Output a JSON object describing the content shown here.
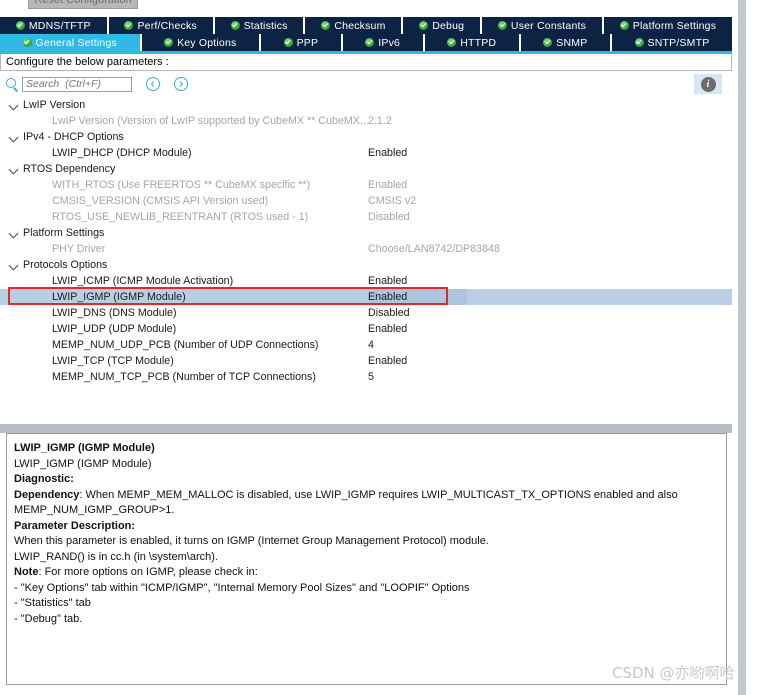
{
  "window": {
    "reset_button_label": "Reset Configuration"
  },
  "tabs": {
    "row1": [
      {
        "label": "MDNS/TFTP",
        "active": false
      },
      {
        "label": "Perf/Checks",
        "active": false
      },
      {
        "label": "Statistics",
        "active": false
      },
      {
        "label": "Checksum",
        "active": false
      },
      {
        "label": "Debug",
        "active": false
      },
      {
        "label": "User Constants",
        "active": false
      },
      {
        "label": "Platform Settings",
        "active": false
      }
    ],
    "row2": [
      {
        "label": "General Settings",
        "active": true
      },
      {
        "label": "Key Options",
        "active": false
      },
      {
        "label": "PPP",
        "active": false
      },
      {
        "label": "IPv6",
        "active": false
      },
      {
        "label": "HTTPD",
        "active": false
      },
      {
        "label": "SNMP",
        "active": false
      },
      {
        "label": "SNTP/SMTP",
        "active": false
      }
    ]
  },
  "configure_bar": {
    "text": "Configure the below parameters :"
  },
  "toolbar": {
    "search_placeholder": "Search  (Ctrl+F)",
    "search_value": "",
    "prev_label": "",
    "next_label": "",
    "info_label": "i"
  },
  "tree": {
    "rows": [
      {
        "kind": "group",
        "label": "LwIP Version",
        "value": ""
      },
      {
        "kind": "param",
        "dim": true,
        "label": "LwIP Version (Version of LwIP supported by CubeMX ** CubeMX...",
        "value": "2.1.2"
      },
      {
        "kind": "group",
        "label": "IPv4 - DHCP Options",
        "value": ""
      },
      {
        "kind": "param",
        "dim": false,
        "label": "LWIP_DHCP (DHCP Module)",
        "value": "Enabled"
      },
      {
        "kind": "group",
        "label": "RTOS Dependency",
        "value": ""
      },
      {
        "kind": "param",
        "dim": true,
        "label": "WITH_RTOS (Use FREERTOS ** CubeMX specific **)",
        "value": "Enabled"
      },
      {
        "kind": "param",
        "dim": true,
        "label": "CMSIS_VERSION (CMSIS API Version used)",
        "value": "CMSIS v2"
      },
      {
        "kind": "param",
        "dim": true,
        "label": "RTOS_USE_NEWLIB_REENTRANT (RTOS used - 1)",
        "value": "Disabled"
      },
      {
        "kind": "group",
        "label": "Platform Settings",
        "value": ""
      },
      {
        "kind": "param",
        "dim": true,
        "label": "PHY Driver",
        "value": "Choose/LAN8742/DP83848"
      },
      {
        "kind": "group",
        "label": "Protocols Options",
        "value": ""
      },
      {
        "kind": "param",
        "dim": false,
        "label": "LWIP_ICMP (ICMP Module Activation)",
        "value": "Enabled"
      },
      {
        "kind": "param",
        "dim": false,
        "selected": true,
        "label": "LWIP_IGMP (IGMP Module)",
        "value": "Enabled"
      },
      {
        "kind": "param",
        "dim": false,
        "label": "LWIP_DNS (DNS Module)",
        "value": "Disabled"
      },
      {
        "kind": "param",
        "dim": false,
        "label": "LWIP_UDP (UDP Module)",
        "value": "Enabled"
      },
      {
        "kind": "param",
        "dim": false,
        "label": "MEMP_NUM_UDP_PCB (Number of UDP Connections)",
        "value": "4"
      },
      {
        "kind": "param",
        "dim": false,
        "label": "LWIP_TCP (TCP Module)",
        "value": "Enabled"
      },
      {
        "kind": "param",
        "dim": false,
        "label": "MEMP_NUM_TCP_PCB (Number of TCP Connections)",
        "value": "5"
      }
    ]
  },
  "description": {
    "lines": [
      {
        "text": "LWIP_IGMP (IGMP Module)",
        "bold": true
      },
      {
        "text": "LWIP_IGMP (IGMP Module)",
        "bold": false
      },
      {
        "text": "Diagnostic:",
        "bold": true
      },
      {
        "lead": "Dependency",
        "text": ": When MEMP_MEM_MALLOC is disabled, use LWIP_IGMP requires LWIP_MULTICAST_TX_OPTIONS enabled and also",
        "bold": false
      },
      {
        "text": "MEMP_NUM_IGMP_GROUP>1.",
        "bold": false
      },
      {
        "text": "Parameter Description:",
        "bold": true
      },
      {
        "text": "When this parameter is enabled, it turns on IGMP (Internet Group Management Protocol) module.",
        "bold": false
      },
      {
        "text": "LWIP_RAND() is in cc.h (in \\system\\arch).",
        "bold": false
      },
      {
        "lead": "Note",
        "text": ": For more options on IGMP, please check in:",
        "bold": false
      },
      {
        "text": "- \"Key Options\" tab within \"ICMP/IGMP\", \"Internal Memory Pool Sizes\" and \"LOOPIF\" Options",
        "bold": false
      },
      {
        "text": "- \"Statistics\" tab",
        "bold": false
      },
      {
        "text": "- \"Debug\" tab.",
        "bold": false
      }
    ]
  },
  "annotation": {
    "highlight_color": "#e8252a"
  },
  "watermark": {
    "text": "CSDN @亦哟啊哈"
  }
}
